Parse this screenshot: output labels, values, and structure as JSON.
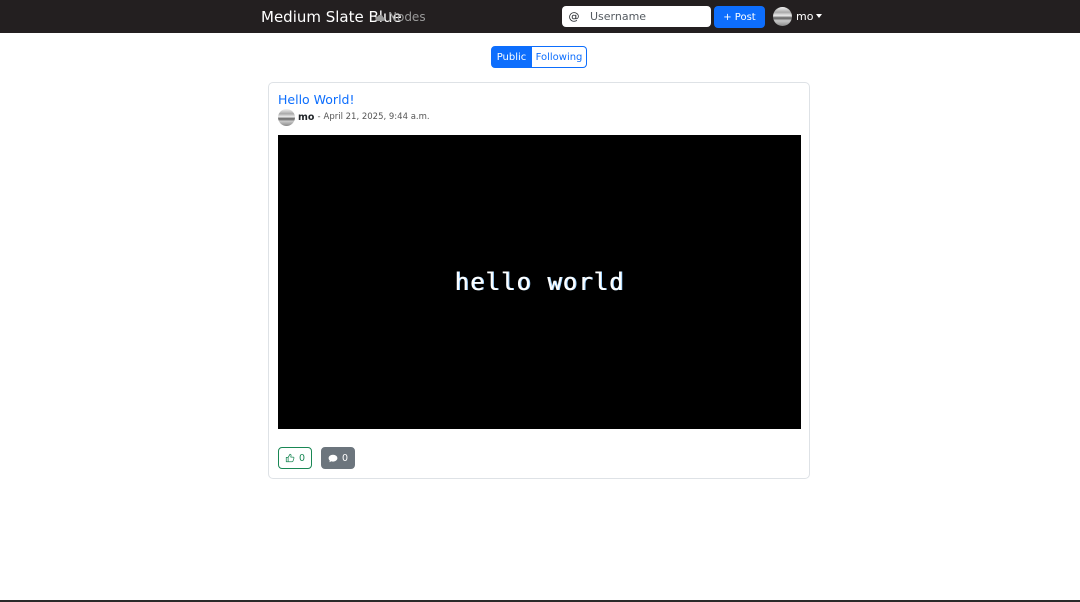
{
  "navbar": {
    "brand": "Medium Slate Blue",
    "nodes_label": "Nodes",
    "search": {
      "prefix": "@",
      "placeholder": "Username",
      "value": ""
    },
    "post_label": "+ Post",
    "user_name": "mo"
  },
  "feed_tabs": [
    {
      "label": "Public",
      "active": true
    },
    {
      "label": "Following",
      "active": false
    }
  ],
  "post": {
    "title": "Hello World!",
    "author": "mo",
    "separator": "-",
    "date": "April 21, 2025, 9:44 a.m.",
    "media_text": "hello world",
    "likes": "0",
    "comments": "0"
  },
  "colors": {
    "navbar_bg": "#231f20",
    "primary": "#0d6efd",
    "success": "#198754",
    "secondary": "#6c757d"
  },
  "icons": {
    "nodes": "cloud-icon",
    "like": "thumbs-up-icon",
    "comment": "chat-bubble-icon",
    "menu": "caret-down-icon"
  }
}
